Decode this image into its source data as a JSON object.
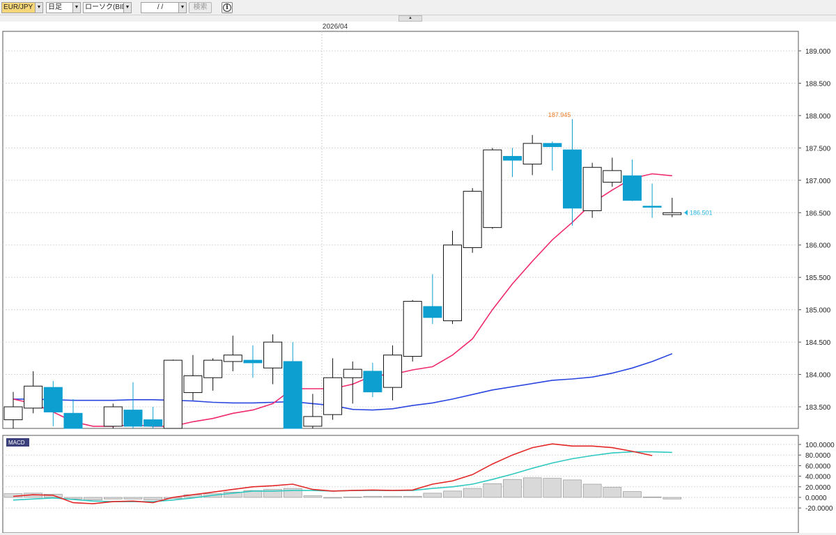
{
  "toolbar": {
    "symbol": "EUR/JPY",
    "timeframe": "日足",
    "chart_style": "ローソク(BID)",
    "date_value": "/ /",
    "search_label": "検索",
    "info_icon": "info-icon",
    "collapse_icon": "collapse-up-icon"
  },
  "colors": {
    "bull_fill": "#ffffff",
    "bear_fill": "#0c9fd0",
    "ma_short": "#ef2a6e",
    "ma_long": "#2a46e0",
    "macd_line": "#e32626",
    "signal_line": "#2ec8c0",
    "high_label": "#ef7b27",
    "current_price": "#27b6e0"
  },
  "chart_data": [
    {
      "type": "candlestick",
      "date_label": "2026/04",
      "high_marker": "187.945",
      "current_price": "186.501",
      "ylim": [
        183.2,
        189.5
      ],
      "y_ticks": [
        "189.000",
        "188.500",
        "188.000",
        "187.500",
        "187.000",
        "186.500",
        "186.000",
        "185.500",
        "185.000",
        "184.500",
        "184.000",
        "183.500"
      ],
      "candles": [
        {
          "o": 183.3,
          "h": 183.73,
          "l": 183.05,
          "c": 183.5
        },
        {
          "o": 183.48,
          "h": 184.05,
          "l": 183.4,
          "c": 183.82
        },
        {
          "o": 183.8,
          "h": 183.9,
          "l": 183.2,
          "c": 183.42
        },
        {
          "o": 183.4,
          "h": 183.62,
          "l": 183.1,
          "c": 183.1
        },
        {
          "o": null,
          "h": null,
          "l": null,
          "c": null
        },
        {
          "o": 183.2,
          "h": 183.55,
          "l": 183.05,
          "c": 183.5
        },
        {
          "o": 183.45,
          "h": 183.88,
          "l": 183.05,
          "c": 183.2
        },
        {
          "o": 183.3,
          "h": 183.5,
          "l": 183.05,
          "c": 183.2
        },
        {
          "o": 183.15,
          "h": 184.23,
          "l": 183.0,
          "c": 184.22
        },
        {
          "o": 183.72,
          "h": 184.3,
          "l": 183.6,
          "c": 183.98
        },
        {
          "o": 183.95,
          "h": 184.25,
          "l": 183.75,
          "c": 184.22
        },
        {
          "o": 184.2,
          "h": 184.6,
          "l": 184.05,
          "c": 184.3
        },
        {
          "o": 184.22,
          "h": 184.45,
          "l": 183.95,
          "c": 184.18
        },
        {
          "o": 184.1,
          "h": 184.62,
          "l": 183.85,
          "c": 184.5
        },
        {
          "o": 184.2,
          "h": 184.5,
          "l": 183.0,
          "c": 183.0
        },
        {
          "o": 183.2,
          "h": 183.7,
          "l": 183.0,
          "c": 183.35
        },
        {
          "o": 183.38,
          "h": 184.25,
          "l": 183.3,
          "c": 183.95
        },
        {
          "o": 183.95,
          "h": 184.2,
          "l": 183.55,
          "c": 184.08
        },
        {
          "o": 184.05,
          "h": 184.18,
          "l": 183.65,
          "c": 183.73
        },
        {
          "o": 183.8,
          "h": 184.45,
          "l": 183.6,
          "c": 184.3
        },
        {
          "o": 184.28,
          "h": 185.15,
          "l": 184.2,
          "c": 185.13
        },
        {
          "o": 185.05,
          "h": 185.55,
          "l": 184.78,
          "c": 184.88
        },
        {
          "o": 184.83,
          "h": 186.22,
          "l": 184.78,
          "c": 186.0
        },
        {
          "o": 185.96,
          "h": 186.88,
          "l": 185.88,
          "c": 186.83
        },
        {
          "o": 186.27,
          "h": 187.5,
          "l": 186.25,
          "c": 187.47
        },
        {
          "o": 187.37,
          "h": 187.5,
          "l": 187.05,
          "c": 187.31
        },
        {
          "o": 187.25,
          "h": 187.7,
          "l": 187.08,
          "c": 187.57
        },
        {
          "o": 187.57,
          "h": 187.6,
          "l": 187.15,
          "c": 187.52
        },
        {
          "o": 187.47,
          "h": 187.945,
          "l": 186.3,
          "c": 186.57
        },
        {
          "o": 186.53,
          "h": 187.27,
          "l": 186.42,
          "c": 187.2
        },
        {
          "o": 186.97,
          "h": 187.35,
          "l": 186.9,
          "c": 187.15
        },
        {
          "o": 187.07,
          "h": 187.32,
          "l": 186.68,
          "c": 186.69
        },
        {
          "o": 186.6,
          "h": 186.95,
          "l": 186.42,
          "c": 186.59
        },
        {
          "o": 186.47,
          "h": 186.73,
          "l": 186.43,
          "c": 186.5
        }
      ],
      "ma_short": [
        183.62,
        183.55,
        183.42,
        183.27,
        183.2,
        183.2,
        183.22,
        183.2,
        183.2,
        183.27,
        183.32,
        183.4,
        183.45,
        183.55,
        183.78,
        183.78,
        183.78,
        183.85,
        183.98,
        184.0,
        184.07,
        184.12,
        184.3,
        184.55,
        185.0,
        185.4,
        185.75,
        186.08,
        186.35,
        186.65,
        186.85,
        187.03,
        187.1,
        187.07
      ],
      "ma_long": [
        183.62,
        183.62,
        183.61,
        183.6,
        183.6,
        183.6,
        183.61,
        183.61,
        183.6,
        183.59,
        183.57,
        183.56,
        183.56,
        183.57,
        183.58,
        183.55,
        183.52,
        183.46,
        183.45,
        183.47,
        183.52,
        183.56,
        183.62,
        183.69,
        183.76,
        183.81,
        183.86,
        183.91,
        183.93,
        183.96,
        184.02,
        184.1,
        184.2,
        184.32
      ],
      "series": [
        {
          "name": "MACD",
          "values": [
            2,
            5,
            4,
            -10,
            -12,
            -8,
            -7,
            -10,
            0,
            5,
            10,
            15,
            20,
            22,
            25,
            15,
            12,
            13,
            14,
            13,
            14,
            25,
            31,
            43,
            63,
            80,
            94,
            101,
            97,
            97,
            94,
            87,
            79
          ]
        },
        {
          "name": "Signal",
          "values": [
            -5,
            -3,
            -1,
            -4,
            -7,
            -8,
            -8,
            -8,
            -5,
            -1,
            4,
            8,
            12,
            12,
            13,
            13,
            12,
            13,
            13,
            13,
            13,
            17,
            20,
            25,
            34,
            44,
            55,
            65,
            73,
            79,
            84,
            86,
            86,
            85
          ]
        }
      ],
      "histogram": [
        7,
        8,
        6,
        -3,
        -5,
        -3,
        -3,
        -5,
        -2,
        5,
        7,
        10,
        13,
        15,
        17,
        3,
        0,
        1,
        2,
        2,
        2,
        8,
        12,
        17,
        26,
        34,
        37,
        36,
        33,
        25,
        19,
        11,
        1,
        -3
      ],
      "macd_label": "MACD",
      "macd_ticks": [
        "100.0000",
        "80.0000",
        "60.0000",
        "40.0000",
        "20.0000",
        "0.0000",
        "-20.0000"
      ],
      "macd_ylim": [
        -20,
        105
      ]
    }
  ]
}
